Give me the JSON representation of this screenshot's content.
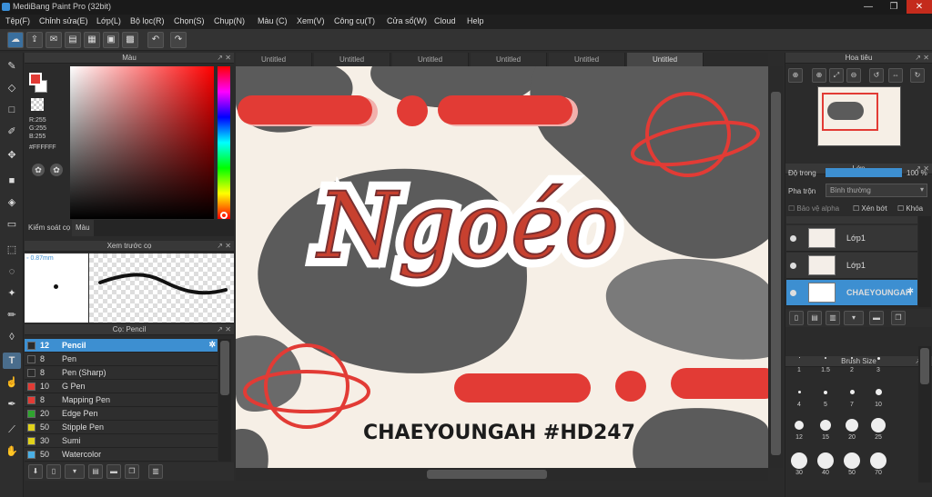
{
  "window": {
    "title": "MediBang Paint Pro (32bit)",
    "min": "—",
    "max": "❐",
    "close": "✕"
  },
  "menu": [
    "Tệp(F)",
    "Chỉnh sửa(E)",
    "Lớp(L)",
    "Bộ lọc(R)",
    "Chọn(S)",
    "Chụp(N)",
    "Màu (C)",
    "Xem(V)",
    "Công cụ(T)",
    "Cửa sổ(W)",
    "Cloud",
    "Help"
  ],
  "color_panel": {
    "title": "Màu",
    "rgb_r": "R:255",
    "rgb_g": "G:255",
    "rgb_b": "B:255",
    "hex": "#FFFFFF",
    "tabs": [
      "Kiểm soát cọ",
      "Màu"
    ],
    "fg_color": "#e23b35",
    "bg_color": "#ffffff"
  },
  "preview_panel": {
    "title": "Xem trước cọ",
    "size": "0.87mm"
  },
  "brush_panel": {
    "title": "Cọ: Pencil",
    "brushes": [
      {
        "size": "12",
        "name": "Pencil",
        "color": "#2a2a2a"
      },
      {
        "size": "8",
        "name": "Pen",
        "color": "#2a2a2a"
      },
      {
        "size": "8",
        "name": "Pen (Sharp)",
        "color": "#2a2a2a"
      },
      {
        "size": "10",
        "name": "G Pen",
        "color": "#e23b35"
      },
      {
        "size": "8",
        "name": "Mapping Pen",
        "color": "#e23b35"
      },
      {
        "size": "20",
        "name": "Edge Pen",
        "color": "#2fa52f"
      },
      {
        "size": "50",
        "name": "Stipple Pen",
        "color": "#e0d21a"
      },
      {
        "size": "30",
        "name": "Sumi",
        "color": "#e0d21a"
      },
      {
        "size": "50",
        "name": "Watercolor",
        "color": "#4ab0e6"
      }
    ]
  },
  "tabs": [
    "Untitled",
    "Untitled",
    "Untitled",
    "Untitled",
    "Untitled",
    "Untitled"
  ],
  "canvas": {
    "title_text": "Ngoéo",
    "bottom_text": "CHAEYOUNGAH #HD247",
    "accent": "#e23b35",
    "cream": "#f6efe6",
    "blob": "#5a5a5a"
  },
  "navigator": {
    "title": "Hoa tiêu"
  },
  "layers": {
    "title": "Lớp",
    "opacity_label": "Độ trong",
    "opacity_value": "100 %",
    "blend_label": "Pha trộn",
    "blend_value": "Bình thường",
    "protect_alpha": "Bảo vệ alpha",
    "clipping": "Xén bớt",
    "lock": "Khóa",
    "items": [
      {
        "name": "Lớp1",
        "selected": false
      },
      {
        "name": "Lớp1",
        "selected": false
      },
      {
        "name": "CHAEYOUNGAH",
        "selected": true
      }
    ]
  },
  "brush_size": {
    "title": "Brush Size",
    "sizes": [
      "1",
      "1.5",
      "2",
      "3",
      "4",
      "5",
      "7",
      "10",
      "12",
      "15",
      "20",
      "25",
      "30",
      "40",
      "50",
      "70"
    ]
  }
}
